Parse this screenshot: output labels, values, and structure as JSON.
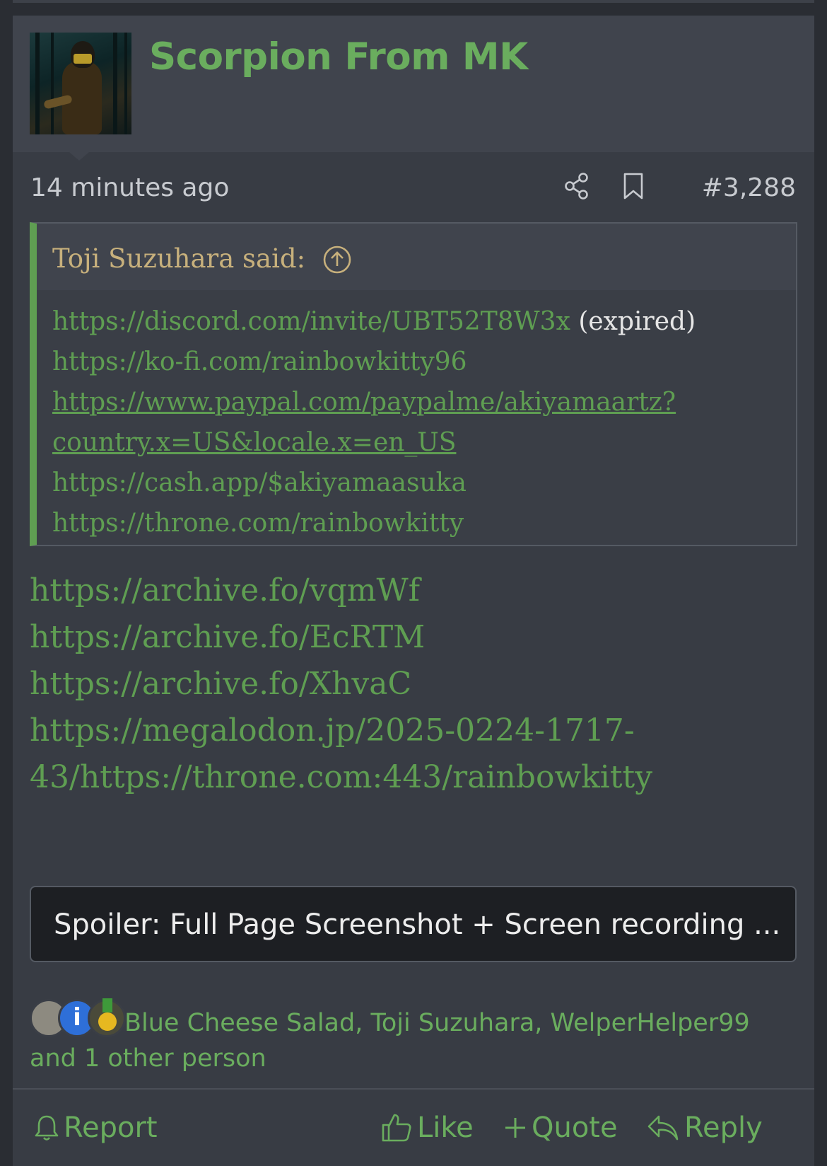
{
  "post": {
    "author": "Scorpion From MK",
    "timestamp": "14 minutes ago",
    "post_number": "#3,288",
    "quote": {
      "attribution": "Toji Suzuhara said:",
      "lines": [
        {
          "link": "https://discord.com/invite/UBT52T8W3x",
          "suffix": " (expired)"
        },
        {
          "link": "https://ko-fi.com/rainbowkitty96"
        },
        {
          "link": "https://www.paypal.com/paypalme/akiyamaartz?"
        },
        {
          "link": "country.x=US&locale.x=en_US"
        },
        {
          "link": "https://cash.app/$akiyamaasuka"
        },
        {
          "link": "https://throne.com/rainbowkitty"
        }
      ]
    },
    "links": [
      "https://archive.fo/vqmWf",
      "https://archive.fo/EcRTM",
      "https://archive.fo/XhvaC",
      "https://megalodon.jp/2025-0224-1717-",
      "43/https://throne.com:443/rainbowkitty"
    ],
    "spoiler_label": "Spoiler: Full Page Screenshot + Screen recording ...",
    "reactions": {
      "names": "Blue Cheese Salad, Toji Suzuhara, WelperHelper99",
      "others": "and 1 other person",
      "info_badge_letter": "i"
    },
    "actions": {
      "report": "Report",
      "like": "Like",
      "quote": "Quote",
      "reply": "Reply"
    }
  },
  "colors": {
    "accent_green": "#6aad5e",
    "link_green": "#5f9e52",
    "background": "#383c44"
  }
}
